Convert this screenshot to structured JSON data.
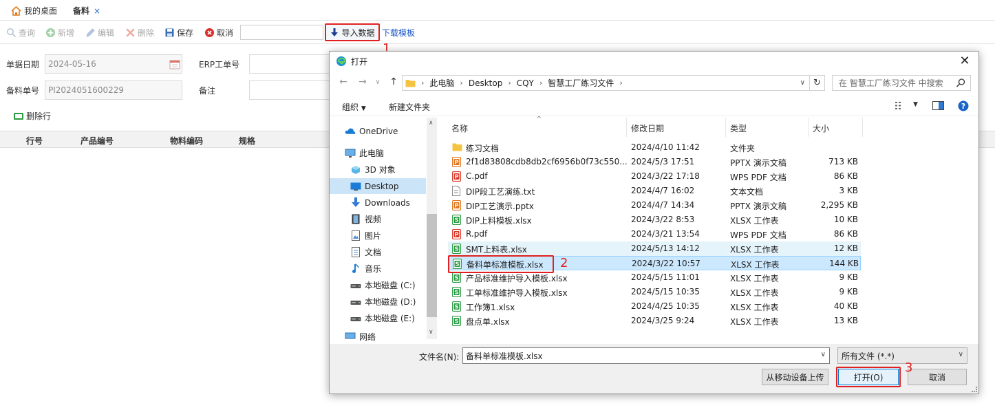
{
  "tabs": {
    "home": "我的桌面",
    "current": "备料",
    "close": "×"
  },
  "toolbar": {
    "query": "查询",
    "add": "新增",
    "edit": "编辑",
    "delete": "删除",
    "save": "保存",
    "cancel": "取消",
    "import": "导入数据",
    "download": "下载模板"
  },
  "form": {
    "date_label": "单据日期",
    "date_value": "2024-05-16",
    "erp_label": "ERP工单号",
    "erp_value": "",
    "code_label": "备料单号",
    "code_value": "PI2024051600229",
    "remark_label": "备注",
    "remark_value": "",
    "delete_row": "删除行"
  },
  "grid": {
    "columns": [
      "行号",
      "产品编号",
      "物料编码",
      "规格"
    ]
  },
  "annotations": [
    "1",
    "2",
    "3"
  ],
  "dialog": {
    "title": "打开",
    "close": "✕",
    "path": [
      "此电脑",
      "Desktop",
      "CQY",
      "智慧工厂练习文件"
    ],
    "search_placeholder": "在 智慧工厂练习文件 中搜索",
    "organize": "组织",
    "new_folder": "新建文件夹",
    "sidebar": [
      {
        "label": "OneDrive",
        "icon": "cloud-icon"
      },
      {
        "label": "此电脑",
        "icon": "computer-icon"
      },
      {
        "label": "3D 对象",
        "icon": "cube-icon"
      },
      {
        "label": "Desktop",
        "icon": "desktop-icon",
        "selected": true
      },
      {
        "label": "Downloads",
        "icon": "download-icon"
      },
      {
        "label": "视频",
        "icon": "video-icon"
      },
      {
        "label": "图片",
        "icon": "picture-icon"
      },
      {
        "label": "文档",
        "icon": "document-icon"
      },
      {
        "label": "音乐",
        "icon": "music-icon"
      },
      {
        "label": "本地磁盘 (C:)",
        "icon": "drive-icon"
      },
      {
        "label": "本地磁盘 (D:)",
        "icon": "drive-icon"
      },
      {
        "label": "本地磁盘 (E:)",
        "icon": "drive-icon"
      },
      {
        "label": "网络",
        "icon": "network-icon"
      }
    ],
    "columns": {
      "name": "名称",
      "date": "修改日期",
      "type": "类型",
      "size": "大小"
    },
    "files": [
      {
        "name": "练习文档",
        "date": "2024/4/10 11:42",
        "type": "文件夹",
        "size": "",
        "icon": "folder",
        "color": "#f5c342"
      },
      {
        "name": "2f1d83808cdb8db2cf6956b0f73c550...",
        "date": "2024/5/3 17:51",
        "type": "PPTX 演示文稿",
        "size": "713 KB",
        "icon": "pptx",
        "color": "#e0751f"
      },
      {
        "name": "C.pdf",
        "date": "2024/3/22 17:18",
        "type": "WPS PDF 文档",
        "size": "86 KB",
        "icon": "pdf",
        "color": "#d9392b"
      },
      {
        "name": "DIP段工艺演练.txt",
        "date": "2024/4/7 16:02",
        "type": "文本文档",
        "size": "3 KB",
        "icon": "txt",
        "color": "#8a8a8a"
      },
      {
        "name": "DIP工艺演示.pptx",
        "date": "2024/4/7 14:34",
        "type": "PPTX 演示文稿",
        "size": "2,295 KB",
        "icon": "pptx",
        "color": "#e0751f"
      },
      {
        "name": "DIP上料模板.xlsx",
        "date": "2024/3/22 8:53",
        "type": "XLSX 工作表",
        "size": "10 KB",
        "icon": "xlsx",
        "color": "#2e9b46"
      },
      {
        "name": "R.pdf",
        "date": "2024/3/21 13:54",
        "type": "WPS PDF 文档",
        "size": "86 KB",
        "icon": "pdf",
        "color": "#d9392b"
      },
      {
        "name": "SMT上料表.xlsx",
        "date": "2024/5/13 14:12",
        "type": "XLSX 工作表",
        "size": "12 KB",
        "icon": "xlsx",
        "color": "#2e9b46",
        "hover": true
      },
      {
        "name": "备料单标准模板.xlsx",
        "date": "2024/3/22 10:57",
        "type": "XLSX 工作表",
        "size": "144 KB",
        "icon": "xlsx",
        "color": "#2e9b46",
        "selected": true
      },
      {
        "name": "产品标准维护导入模板.xlsx",
        "date": "2024/5/15 11:01",
        "type": "XLSX 工作表",
        "size": "9 KB",
        "icon": "xlsx",
        "color": "#2e9b46"
      },
      {
        "name": "工单标准维护导入模板.xlsx",
        "date": "2024/5/15 10:35",
        "type": "XLSX 工作表",
        "size": "9 KB",
        "icon": "xlsx",
        "color": "#2e9b46"
      },
      {
        "name": "工作簿1.xlsx",
        "date": "2024/4/25 10:35",
        "type": "XLSX 工作表",
        "size": "40 KB",
        "icon": "xlsx",
        "color": "#2e9b46"
      },
      {
        "name": "盘点单.xlsx",
        "date": "2024/3/25 9:24",
        "type": "XLSX 工作表",
        "size": "13 KB",
        "icon": "xlsx",
        "color": "#2e9b46"
      }
    ],
    "filename_label": "文件名(N):",
    "filename_value": "备料单标准模板.xlsx",
    "filetype_value": "所有文件 (*.*)",
    "upload_mobile": "从移动设备上传",
    "open": "打开(O)",
    "cancel": "取消"
  },
  "colors": {
    "accent_red": "#e02020",
    "link_blue": "#1a55c9",
    "selection": "#cce8ff"
  }
}
